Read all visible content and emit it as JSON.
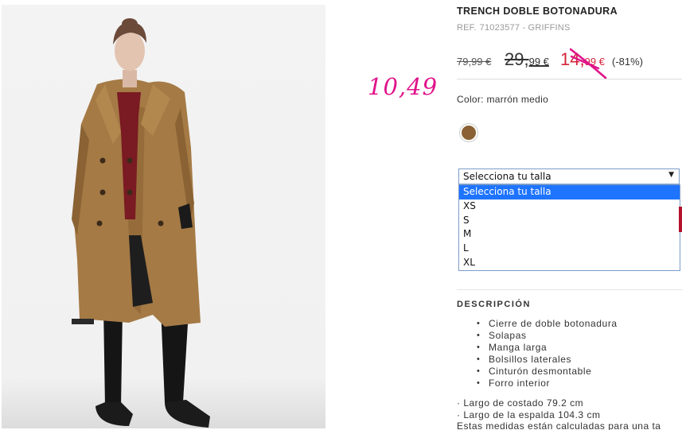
{
  "product": {
    "title": "TRENCH DOBLE BOTONADURA",
    "ref_label": "REF.",
    "ref_value": "71023577 - GRIFFINS",
    "price_original": "79,99 €",
    "price_mid_int": "29,",
    "price_mid_cents": "99 €",
    "price_sale_int": "14,",
    "price_sale_cents": "99 €",
    "discount": "(-81%)",
    "handwritten_price": "10,49",
    "color_label": "Color: marrón medio",
    "color_swatch": "#8b6034",
    "size_select": {
      "selected": "Selecciona tu talla",
      "options": [
        "Selecciona tu talla",
        "XS",
        "S",
        "M",
        "L",
        "XL"
      ]
    },
    "description": {
      "title": "DESCRIPCIÓN",
      "features": [
        "Cierre de doble botonadura",
        "Solapas",
        "Manga larga",
        "Bolsillos laterales",
        "Cinturón desmontable",
        "Forro interior"
      ],
      "measures": [
        "· Largo de costado 79.2 cm",
        "· Largo de la espalda 104.3 cm",
        "Estas medidas están calculadas para una ta"
      ]
    }
  },
  "colors": {
    "sale_red": "#d4243a",
    "annotation_pink": "#e0138a",
    "select_highlight": "#1e74ff"
  }
}
